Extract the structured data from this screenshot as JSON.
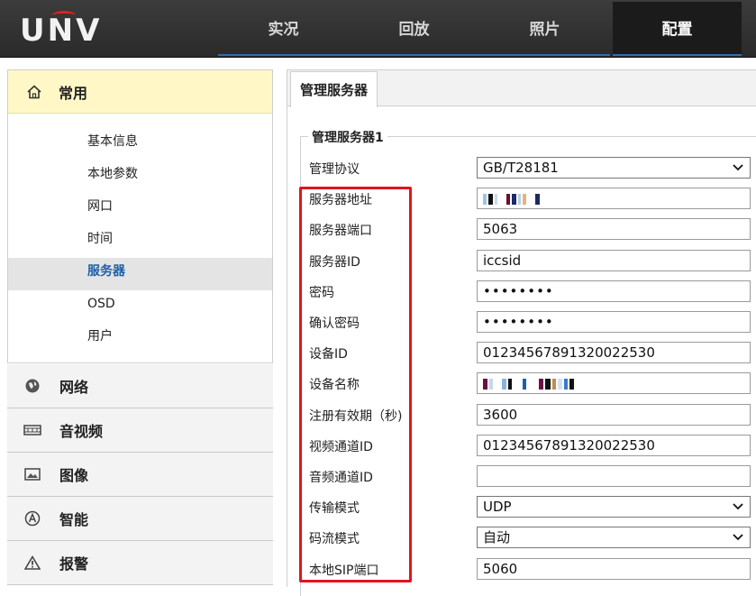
{
  "brand": {
    "logo_text": "UNV",
    "arc_color": "#e02020"
  },
  "nav": {
    "tabs": [
      "实况",
      "回放",
      "照片",
      "配置"
    ],
    "active": "配置"
  },
  "sidebar": {
    "common": {
      "title": "常用",
      "items": [
        "基本信息",
        "本地参数",
        "网口",
        "时间",
        "服务器",
        "OSD",
        "用户"
      ],
      "active": "服务器"
    },
    "sections": [
      {
        "label": "网络",
        "icon": "globe-icon"
      },
      {
        "label": "音视频",
        "icon": "film-icon"
      },
      {
        "label": "图像",
        "icon": "image-icon"
      },
      {
        "label": "智能",
        "icon": "smart-icon"
      },
      {
        "label": "报警",
        "icon": "warning-icon"
      }
    ]
  },
  "content": {
    "tab_label": "管理服务器",
    "group_title": "管理服务器1",
    "fields": {
      "protocol": {
        "label": "管理协议",
        "value": "GB/T28181"
      },
      "server_address": {
        "label": "服务器地址",
        "value": ""
      },
      "server_port": {
        "label": "服务器端口",
        "value": "5063"
      },
      "server_id": {
        "label": "服务器ID",
        "value": "iccsid"
      },
      "password": {
        "label": "密码",
        "value": "••••••••"
      },
      "confirm_password": {
        "label": "确认密码",
        "value": "••••••••"
      },
      "device_id": {
        "label": "设备ID",
        "value": "01234567891320022530"
      },
      "device_name": {
        "label": "设备名称",
        "value": ""
      },
      "register_period": {
        "label": "注册有效期（秒)",
        "value": "3600"
      },
      "video_channel_id": {
        "label": "视频通道ID",
        "value": "01234567891320022530"
      },
      "audio_channel_id": {
        "label": "音频通道ID",
        "value": ""
      },
      "transport_mode": {
        "label": "传输模式",
        "value": "UDP"
      },
      "stream_mode": {
        "label": "码流模式",
        "value": "自动"
      },
      "local_sip_port": {
        "label": "本地SIP端口",
        "value": "5060"
      }
    }
  },
  "colors": {
    "highlight_box": "#e0141e",
    "active_sub_item": "#1f5fa8",
    "group_header_bg": "#fff8c6",
    "topbar_bg": "#2a2a2a"
  }
}
